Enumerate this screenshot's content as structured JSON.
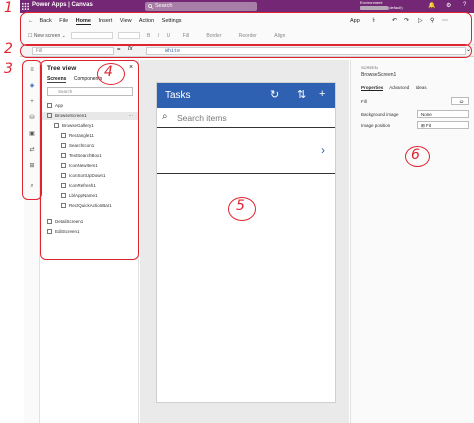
{
  "topbar": {
    "app_title": "Power Apps | Canvas",
    "search_placeholder": "Search",
    "environment_label": "Environment",
    "environment_value": "(default)",
    "avatar_initials": "GD"
  },
  "menu": {
    "back": "Back",
    "items": [
      "File",
      "Home",
      "Insert",
      "View",
      "Action",
      "Settings"
    ],
    "active": "Home",
    "app_label": "App"
  },
  "ribbon": {
    "new_screen": "New screen",
    "items": [
      "B",
      "/",
      "U",
      "Fill",
      "Border",
      "Reorder",
      "Align"
    ]
  },
  "formula": {
    "property": "Fill",
    "fx": "fx",
    "value": "White"
  },
  "tree": {
    "title": "Tree view",
    "tabs": [
      "Screens",
      "Components"
    ],
    "active_tab": "Screens",
    "search_placeholder": "Search",
    "items": [
      {
        "label": "App",
        "level": 0
      },
      {
        "label": "BrowseScreen1",
        "level": 0,
        "selected": true
      },
      {
        "label": "BrowseGallery1",
        "level": 1
      },
      {
        "label": "Rectangle11",
        "level": 2
      },
      {
        "label": "SearchIcon1",
        "level": 2
      },
      {
        "label": "TextSearchBox1",
        "level": 2
      },
      {
        "label": "IconNewItem1",
        "level": 2
      },
      {
        "label": "IconSortUpDown1",
        "level": 2
      },
      {
        "label": "IconRefresh1",
        "level": 2
      },
      {
        "label": "LblAppName1",
        "level": 2
      },
      {
        "label": "RectQuickActionBar1",
        "level": 2
      },
      {
        "label": "DetailScreen1",
        "level": 0
      },
      {
        "label": "EditScreen1",
        "level": 0
      }
    ]
  },
  "canvas": {
    "header_title": "Tasks",
    "search_placeholder": "Search items"
  },
  "properties": {
    "kind": "SCREEN",
    "name": "BrowseScreen1",
    "tabs": [
      "Properties",
      "Advanced",
      "Ideas"
    ],
    "active_tab": "Properties",
    "rows": [
      {
        "label": "Fill",
        "value": ""
      },
      {
        "label": "Background image",
        "value": "None"
      },
      {
        "label": "Image position",
        "value": "Fit"
      }
    ]
  },
  "annotations": [
    "1",
    "2",
    "3",
    "4",
    "5",
    "6"
  ],
  "colors": {
    "brand": "#742774",
    "app_header": "#2f61b3",
    "annotation": "#e0242f"
  }
}
